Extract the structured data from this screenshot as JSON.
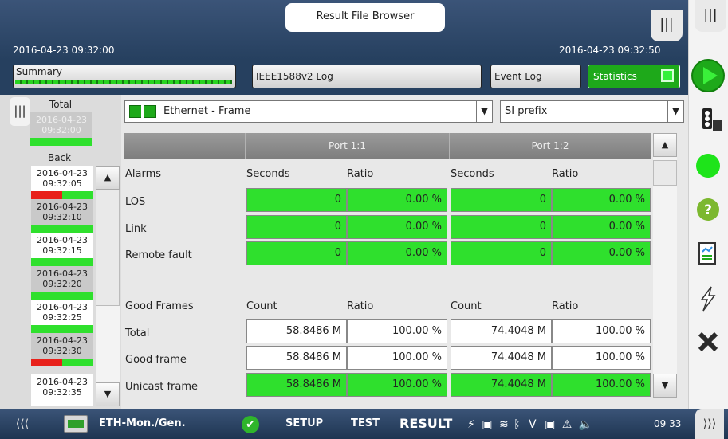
{
  "header": {
    "title": "Result File Browser",
    "start_time": "2016-04-23 09:32:00",
    "end_time": "2016-04-23 09:32:50",
    "corner_icon": "|||"
  },
  "tabs": {
    "summary": "Summary",
    "ieee_log": "IEEE1588v2 Log",
    "event_log": "Event Log",
    "statistics": "Statistics"
  },
  "left": {
    "total_label": "Total",
    "total_date": "2016-04-23",
    "total_time": "09:32:00",
    "back_label": "Back",
    "entries": [
      {
        "date": "2016-04-23",
        "time": "09:32:05"
      },
      {
        "date": "2016-04-23",
        "time": "09:32:10"
      },
      {
        "date": "2016-04-23",
        "time": "09:32:15"
      },
      {
        "date": "2016-04-23",
        "time": "09:32:20"
      },
      {
        "date": "2016-04-23",
        "time": "09:32:25"
      },
      {
        "date": "2016-04-23",
        "time": "09:32:30"
      },
      {
        "date": "2016-04-23",
        "time": "09:32:35"
      }
    ]
  },
  "filters": {
    "view": "Ethernet - Frame",
    "units": "SI prefix"
  },
  "table": {
    "port1": "Port 1:1",
    "port2": "Port 1:2",
    "alarms_label": "Alarms",
    "seconds": "Seconds",
    "ratio": "Ratio",
    "count": "Count",
    "good_frames_label": "Good Frames",
    "alarm_rows": [
      {
        "label": "LOS",
        "p1_sec": "0",
        "p1_ratio": "0.00 %",
        "p2_sec": "0",
        "p2_ratio": "0.00 %"
      },
      {
        "label": "Link",
        "p1_sec": "0",
        "p1_ratio": "0.00 %",
        "p2_sec": "0",
        "p2_ratio": "0.00 %"
      },
      {
        "label": "Remote fault",
        "p1_sec": "0",
        "p1_ratio": "0.00 %",
        "p2_sec": "0",
        "p2_ratio": "0.00 %"
      }
    ],
    "frame_rows": [
      {
        "label": "Total",
        "p1_count": "58.8486 M",
        "p1_ratio": "100.00 %",
        "p2_count": "74.4048 M",
        "p2_ratio": "100.00 %"
      },
      {
        "label": "Good frame",
        "p1_count": "58.8486 M",
        "p1_ratio": "100.00 %",
        "p2_count": "74.4048 M",
        "p2_ratio": "100.00 %"
      },
      {
        "label": "Unicast frame",
        "p1_count": "58.8486 M",
        "p1_ratio": "100.00 %",
        "p2_count": "74.4048 M",
        "p2_ratio": "100.00 %"
      }
    ]
  },
  "bottom": {
    "app_name": "ETH-Mon./Gen.",
    "setup": "SETUP",
    "test": "TEST",
    "result": "RESULT",
    "clock": "09 33"
  },
  "colors": {
    "header_bg": "#26405f",
    "status_green": "#2fe02d",
    "alarm_red": "#e8211b"
  }
}
